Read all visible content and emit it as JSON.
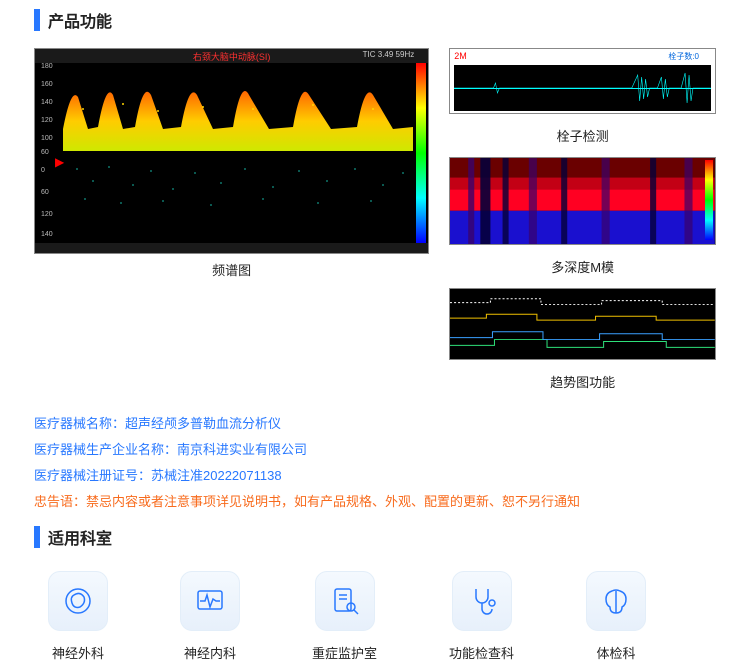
{
  "sections": {
    "functions": "产品功能",
    "departments": "适用科室"
  },
  "charts": {
    "spectral": {
      "caption": "频谱图",
      "header_title": "右颈大脑中动脉(SI)",
      "header_tic": "TIC 3.49   59Hz"
    },
    "emboli": {
      "caption": "栓子检测",
      "label_left": "2M",
      "label_right": "栓子数:0"
    },
    "mmode": {
      "caption": "多深度M模"
    },
    "trend": {
      "caption": "趋势图功能"
    }
  },
  "info": {
    "line1": {
      "label": "医疗器械名称：",
      "value": "超声经颅多普勒血流分析仪"
    },
    "line2": {
      "label": "医疗器械生产企业名称：",
      "value": "南京科进实业有限公司"
    },
    "line3": {
      "label": "医疗器械注册证号：",
      "value": "苏械注准20222071138"
    },
    "warn": {
      "label": "忠告语：",
      "value": "禁忌内容或者注意事项详见说明书，如有产品规格、外观、配置的更新、恕不另行通知"
    }
  },
  "departments": [
    {
      "name": "神经外科"
    },
    {
      "name": "神经内科"
    },
    {
      "name": "重症监护室"
    },
    {
      "name": "功能检查科"
    },
    {
      "name": "体检科"
    }
  ],
  "chart_data": [
    {
      "type": "line",
      "title": "频谱图 (Doppler Spectrogram)",
      "description": "Transcranial Doppler spectral waveform, ~6 cardiac cycles, color-coded flow velocity.",
      "ylim": [
        -140,
        180
      ],
      "x_unit": "time",
      "y_unit": "cm/s (approx)",
      "metadata": {
        "header": "右颈大脑中动脉(SI)",
        "tic": 3.49,
        "rate_hz": 59
      }
    },
    {
      "type": "line",
      "title": "栓子检测 (Emboli Detection)",
      "description": "Single-channel audio waveform strip with emboli spike bursts near right side.",
      "metadata": {
        "probe": "2M",
        "emboli_count": 0
      }
    },
    {
      "type": "heatmap",
      "title": "多深度M模 (Multi-depth M-mode)",
      "description": "Depth vs time color map, dominant red/blue bands indicating bidirectional flow across depths."
    },
    {
      "type": "line",
      "title": "趋势图功能 (Trend Chart)",
      "description": "Multi-series stepped trend lines (≈4 series) of Doppler parameters over time."
    }
  ]
}
